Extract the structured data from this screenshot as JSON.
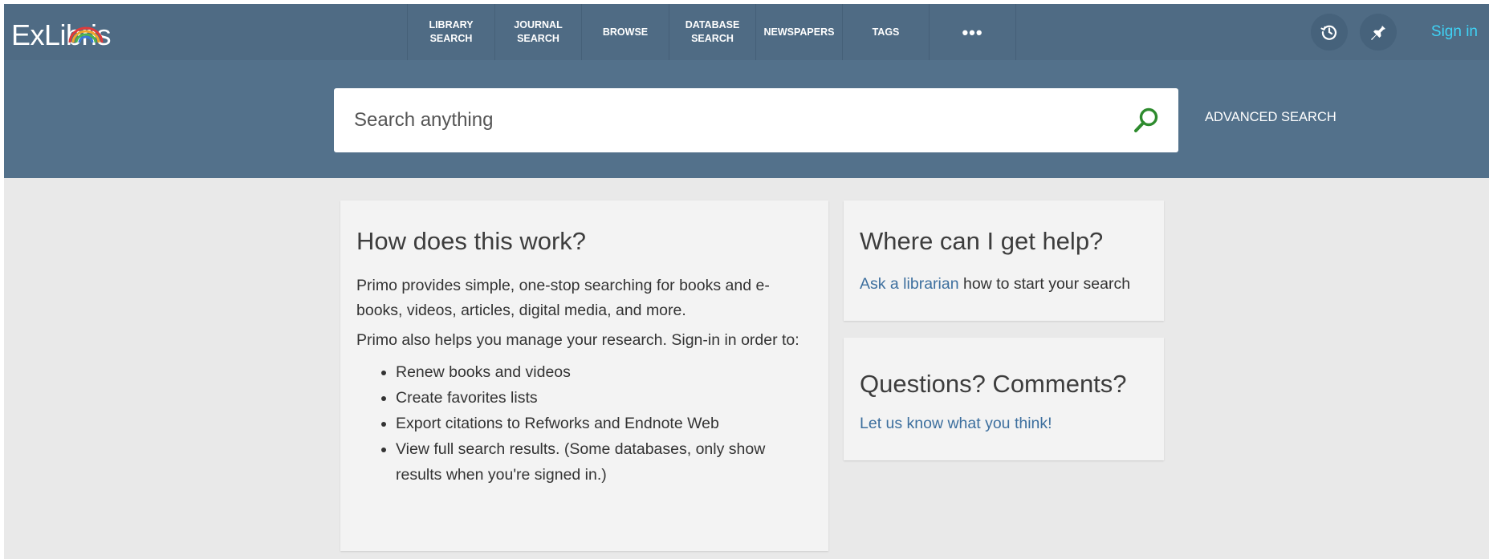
{
  "logo": {
    "text": "ExLibris"
  },
  "nav": {
    "items": [
      {
        "label": "LIBRARY\nSEARCH"
      },
      {
        "label": "JOURNAL\nSEARCH"
      },
      {
        "label": "BROWSE"
      },
      {
        "label": "DATABASE\nSEARCH"
      },
      {
        "label": "NEWSPAPERS"
      },
      {
        "label": "TAGS"
      }
    ],
    "more_label": "•••"
  },
  "header": {
    "history_icon": "history-icon",
    "pin_icon": "pin-icon",
    "signin_label": "Sign in"
  },
  "search": {
    "placeholder": "Search anything",
    "value": "",
    "advanced_label": "ADVANCED SEARCH"
  },
  "how_card": {
    "title": "How does this work?",
    "para1": "Primo provides simple, one-stop searching for books and e-books, videos, articles, digital media, and more.",
    "para2": "Primo also helps you manage your research. Sign-in in order to:",
    "bullets": [
      "Renew books and videos",
      "Create favorites lists",
      "Export citations to Refworks and Endnote Web",
      "View full search results. (Some databases, only show results when you're signed in.)"
    ]
  },
  "help_card": {
    "title": "Where can I get help?",
    "link_text": "Ask a librarian",
    "rest_text": " how to start your search"
  },
  "questions_card": {
    "title": "Questions? Comments?",
    "link_text": "Let us know what you think!"
  },
  "colors": {
    "topbar": "#4f6b84",
    "search_band": "#53718b",
    "link": "#3d6f9e",
    "signin": "#3fd2f5",
    "search_icon": "#2e8b2e"
  }
}
